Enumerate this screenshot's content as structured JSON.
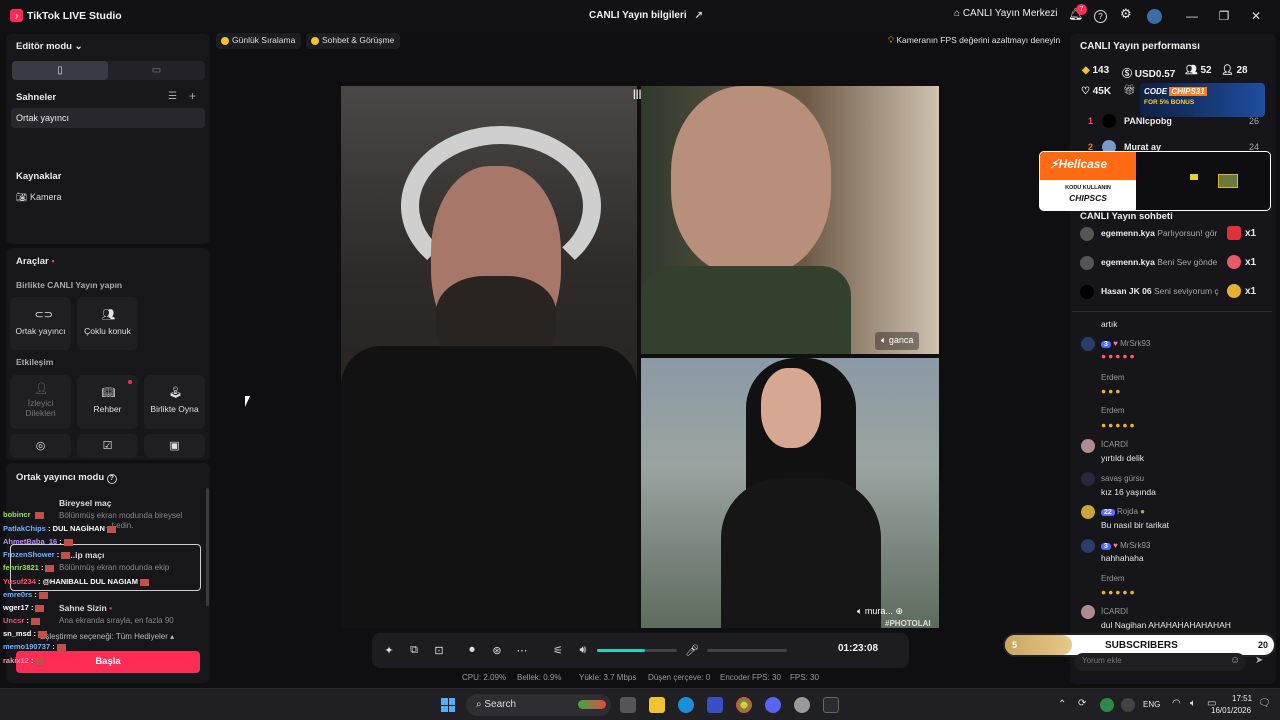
{
  "window": {
    "app_name": "TikTok LIVE Studio",
    "center_title": "CANLI Yayın bilgileri",
    "live_center": "CANLI Yayın Merkezi",
    "notification_count": "7"
  },
  "left": {
    "editor_mode": "Editör modu",
    "scenes_title": "Sahneler",
    "scene_item": "Ortak yayıncı",
    "sources_title": "Kaynaklar",
    "source_camera": "Kamera",
    "tools_title": "Araçlar",
    "together_title": "Birlikte CANLI Yayın yapın",
    "tile_cohost": "Ortak yayıncı",
    "tile_multi": "Çoklu konuk",
    "interaction_title": "Etkileşim",
    "tile_viewer_requests": "İzleyici Dilekleri",
    "tile_guide": "Rehber",
    "tile_play_together": "Birlikte Oyna",
    "cohost_mode_title": "Ortak yayıncı modu",
    "individual_match": "Bireysel maç",
    "individual_desc": "Bölünmüş ekran modunda bireysel",
    "individual_desc2": "...t edin.",
    "team_match": "...ip maçı",
    "team_desc": "Bölünmüş ekran modunda ekip",
    "stage_yours": "Sahne Sizin",
    "stage_desc": "Ana ekranda sırayla, en fazla 90",
    "match_option": "Eşleştirme seçeneği: Tüm Hediyeler",
    "start_button": "Başla"
  },
  "overlay_chat": [
    {
      "name": "bobincr",
      "msg": "",
      "color": "#9be15d"
    },
    {
      "name": "PatlakChips",
      "msg": ": DUL NAGİHAN",
      "color": "#6fb3ff"
    },
    {
      "name": "AhmetBaba_16",
      "msg": ":",
      "color": "#c08cff"
    },
    {
      "name": "FrozenShower",
      "msg": ":",
      "color": "#6fb3ff"
    },
    {
      "name": "fenrir3821",
      "msg": ":",
      "color": "#9be15d"
    },
    {
      "name": "Yusuf234",
      "msg": ": @HANIBALL DUL NAGIAM",
      "color": "#ff4d6d"
    },
    {
      "name": "emre0rs",
      "msg": ":",
      "color": "#6fb3ff"
    },
    {
      "name": "wger17",
      "msg": ":",
      "color": "#ffffff"
    },
    {
      "name": "Uncsr",
      "msg": ":",
      "color": "#ff4d6d"
    },
    {
      "name": "sn_msd",
      "msg": ":",
      "color": "#ffffff"
    },
    {
      "name": "memo190737",
      "msg": ":",
      "color": "#6fb3ff"
    },
    {
      "name": "rakix12",
      "msg": ":",
      "color": "#ff8fb0"
    }
  ],
  "stage": {
    "pill_ranking": "Günlük Sıralama",
    "pill_chat": "Sohbet & Görüşme",
    "hint": "Kameranın FPS değerini azaltmayı deneyin",
    "label_top_right": "ganca",
    "label_bottom_right": "mura...",
    "watermark": "#PHOTOLAI",
    "timer": "01:23:08",
    "volume_level": 0.6
  },
  "stats": {
    "cpu": "CPU: 2.09%",
    "memory": "Bellek: 0.9%",
    "upload": "Yükle: 3.7 Mbps",
    "dropped": "Düşen çerçeve: 0",
    "encoder_fps": "Encoder FPS: 30",
    "fps": "FPS: 30"
  },
  "right": {
    "perf_title": "CANLI Yayın performansı",
    "diamonds": "143",
    "usd": "USD0.57",
    "viewers": "52",
    "followers": "28",
    "likes": "45K",
    "ranking": [
      {
        "rank": "1",
        "name": "PANIcpobg",
        "score": "26"
      },
      {
        "rank": "2",
        "name": "Murat ay",
        "score": "24"
      }
    ],
    "ad_code_title": "CODE",
    "ad_code": "CHIPS31",
    "ad_bonus": "FOR 5% BONUS",
    "ad_hellcase": "Hellcase",
    "ad_kodu": "KODU KULLANIN",
    "ad_chipscs": "CHIPSCS",
    "chat_title": "CANLI Yayın sohbeti",
    "gifts": [
      {
        "name": "egemenn.kya",
        "text": "Parlıyorsun! gör",
        "count": "x1"
      },
      {
        "name": "egemenn.kya",
        "text": "Beni Sev gönde",
        "count": "x1"
      },
      {
        "name": "Hasan JK 06",
        "text": "Seni seviyorum ç",
        "count": "x1"
      }
    ],
    "chat_artik": "artık",
    "u_mrsrk": "MrSrk93",
    "lvl3": "3",
    "u_erdem": "Erdem",
    "u_icardi": "İCARDİ",
    "m_yirtildi": "yırtıldı delik",
    "u_savas": "savaş gürsu",
    "m_kiz": "kız 16 yaşında",
    "lvl22": "22",
    "u_rojda": "Rojda",
    "m_tarikat": "Bu nasıl bir tarikat",
    "m_hahha": "hahhahaha",
    "m_dul": "dul Nagihan AHAHAHAHAHAHAH",
    "sub_left": "5",
    "sub_label": "SUBSCRIBERS",
    "sub_right": "20",
    "comment_placeholder": "Yorum ekle"
  },
  "taskbar": {
    "search": "Search",
    "lang": "ENG",
    "time": "17:51",
    "date": "16/01/2026"
  }
}
